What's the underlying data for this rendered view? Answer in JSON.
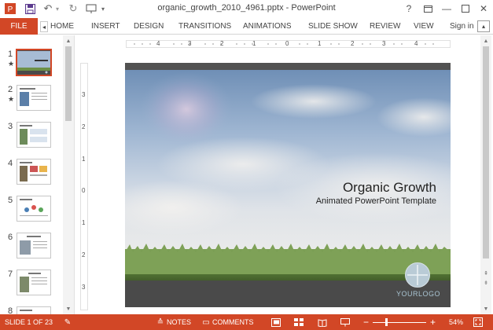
{
  "window": {
    "title": "organic_growth_2010_4961.pptx - PowerPoint",
    "help_glyph": "?",
    "minimize_glyph": "—",
    "close_glyph": "✕"
  },
  "ribbon": {
    "file_label": "FILE",
    "tabs": [
      "HOME",
      "INSERT",
      "DESIGN",
      "TRANSITIONS",
      "ANIMATIONS",
      "SLIDE SHOW",
      "REVIEW",
      "VIEW"
    ],
    "signin_label": "Sign in"
  },
  "thumbnails": [
    {
      "number": "1",
      "star": "★",
      "selected": true
    },
    {
      "number": "2",
      "star": "★",
      "selected": false
    },
    {
      "number": "3",
      "star": "",
      "selected": false
    },
    {
      "number": "4",
      "star": "",
      "selected": false
    },
    {
      "number": "5",
      "star": "",
      "selected": false
    },
    {
      "number": "6",
      "star": "",
      "selected": false
    },
    {
      "number": "7",
      "star": "",
      "selected": false
    },
    {
      "number": "8",
      "star": "",
      "selected": false
    }
  ],
  "ruler": {
    "horizontal_labels": [
      "4",
      "3",
      "2",
      "1",
      "0",
      "1",
      "2",
      "3",
      "4"
    ],
    "vertical_labels": [
      "3",
      "2",
      "1",
      "0",
      "1",
      "2",
      "3"
    ]
  },
  "slide": {
    "title": "Organic Growth",
    "subtitle": "Animated PowerPoint Template",
    "logo_text": "YOURLOGO"
  },
  "status": {
    "slide_info": "SLIDE 1 OF 23",
    "notes_label": "NOTES",
    "comments_label": "COMMENTS",
    "zoom_minus": "−",
    "zoom_plus": "+",
    "zoom_level": "54%"
  },
  "colors": {
    "accent": "#d24726"
  },
  "icons": [
    "save-icon",
    "undo-icon",
    "redo-icon",
    "present-icon",
    "customize-icon",
    "help-icon",
    "restore-icon",
    "minimize-icon",
    "maximize-icon",
    "close-icon",
    "spellcheck-icon",
    "notes-icon",
    "comments-icon",
    "normal-view-icon",
    "slide-sorter-icon",
    "reading-view-icon",
    "slideshow-icon",
    "fit-slide-icon"
  ]
}
